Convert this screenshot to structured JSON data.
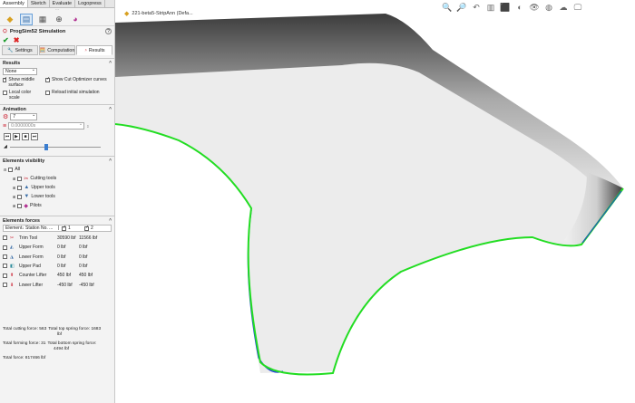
{
  "tabs": [
    "Assembly",
    "Sketch",
    "Evaluate",
    "Logopress"
  ],
  "title": "ProgSim52 Simulation",
  "help": "?",
  "subtabs": [
    "Settings",
    "Computation",
    "Results"
  ],
  "results": {
    "header": "Results",
    "select_value": "None",
    "opt_show_middle": "Show middle surface",
    "opt_show_cut": "Show Cut Optimizer curves",
    "opt_local_color": "Local color scale",
    "opt_reload": "Reload initial simulation"
  },
  "animation": {
    "header": "Animation",
    "step_value": "7",
    "time_value": "0.0000000s"
  },
  "elements_visibility": {
    "header": "Elements visibility",
    "items": [
      "All",
      "Cutting tools",
      "Upper tools",
      "Lower tools",
      "Pilots"
    ]
  },
  "elements_forces": {
    "header": "Elements forces",
    "columns": [
      "Element",
      "Station No. ...",
      "1",
      "2"
    ],
    "rows": [
      {
        "name": "Trim Tool",
        "v1": "30590 lbf",
        "v2": "11566 lbf"
      },
      {
        "name": "Upper Form",
        "v1": "0 lbf",
        "v2": "0 lbf"
      },
      {
        "name": "Lower Form",
        "v1": "0 lbf",
        "v2": "0 lbf"
      },
      {
        "name": "Upper Pad",
        "v1": "0 lbf",
        "v2": "0 lbf"
      },
      {
        "name": "Counter Lifter",
        "v1": "450 lbf",
        "v2": "450 lbf"
      },
      {
        "name": "Lower Lifter",
        "v1": "-450 lbf",
        "v2": "-450 lbf"
      }
    ],
    "summary_cutting": "Total cutting force: 563",
    "summary_top_spring": "Total top spring force: 1683",
    "summary_top_spring_unit": "lbf",
    "summary_forming": "Total forming force: 31",
    "summary_bottom_spring": "Total bottom spring force:",
    "summary_bottom_spring_value": "4494 lbf",
    "summary_total": "Total force: 817466 lbf"
  },
  "viewport": {
    "breadcrumb": "221-beta5-StripAnn (Defa..."
  },
  "colors": {
    "curve_green": "#22dd22",
    "curve_blue": "#1f3fd8",
    "accent": "#6aa0d8"
  }
}
